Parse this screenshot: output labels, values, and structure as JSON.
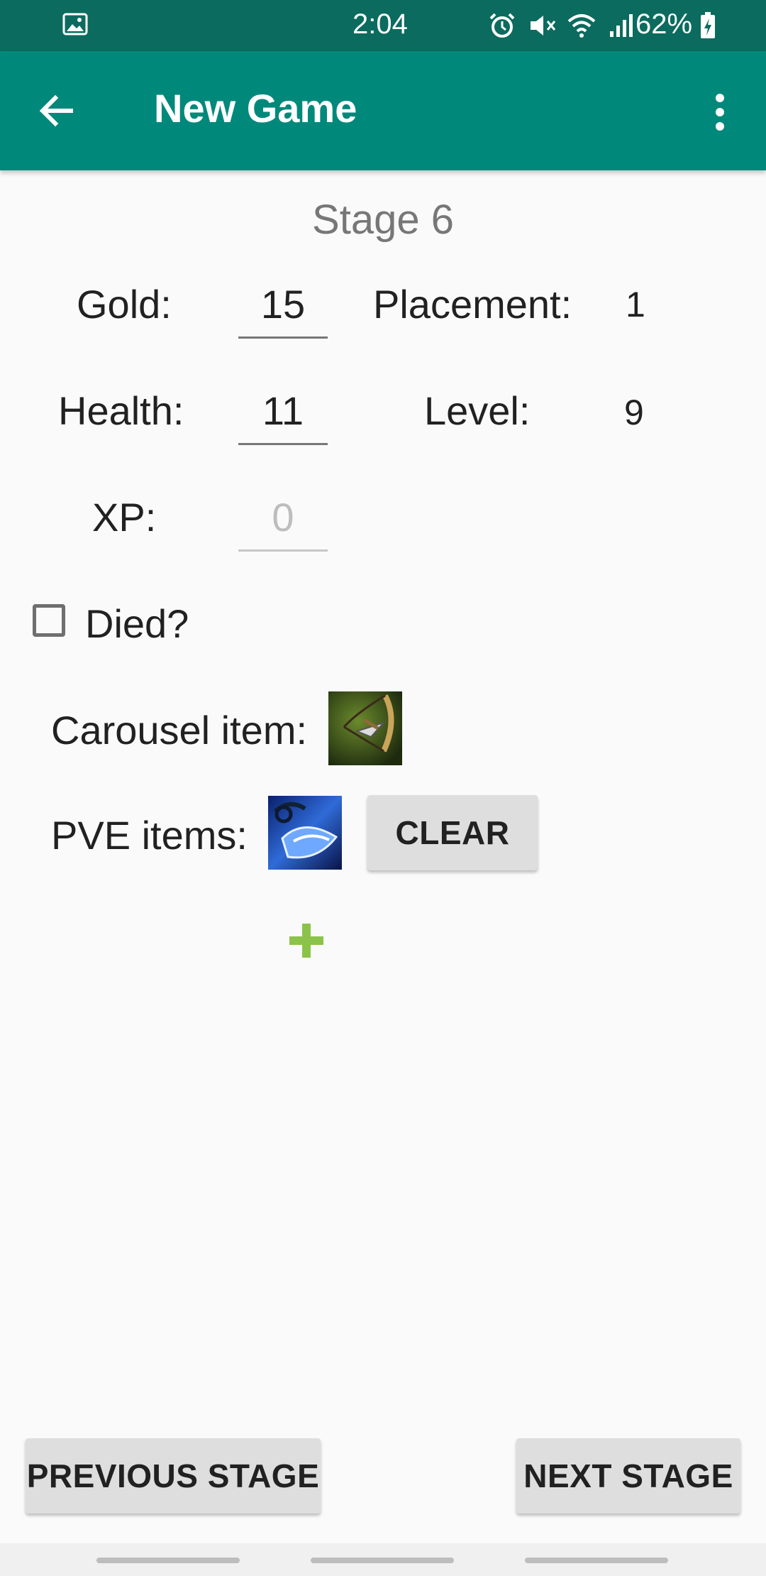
{
  "status_bar": {
    "time": "2:04",
    "battery": "62%",
    "icons": [
      "image-icon",
      "alarm-icon",
      "mute-icon",
      "wifi-icon",
      "signal-icon",
      "battery-charging-icon"
    ]
  },
  "app_bar": {
    "title": "New Game",
    "back_icon": "arrow-left-icon",
    "menu_icon": "more-vertical-icon"
  },
  "stage": {
    "title": "Stage 6"
  },
  "stats": {
    "gold_label": "Gold:",
    "gold_value": "15",
    "placement_label": "Placement:",
    "placement_value": "1",
    "health_label": "Health:",
    "health_value": "11",
    "level_label": "Level:",
    "level_value": "9",
    "xp_label": "XP:",
    "xp_placeholder": "0"
  },
  "died": {
    "label": "Died?",
    "checked": false
  },
  "carousel": {
    "label": "Carousel item:",
    "item_icon": "bow-item-icon"
  },
  "pve": {
    "label": "PVE items:",
    "item_icon": "blue-item-icon",
    "clear_label": "CLEAR"
  },
  "add": {
    "icon": "plus-icon",
    "color": "#8bc34a"
  },
  "footer": {
    "previous_label": "PREVIOUS STAGE",
    "next_label": "NEXT STAGE"
  },
  "colors": {
    "app_bar": "#00897b",
    "status_bar": "#0b6b5e",
    "background": "#fafafa"
  }
}
